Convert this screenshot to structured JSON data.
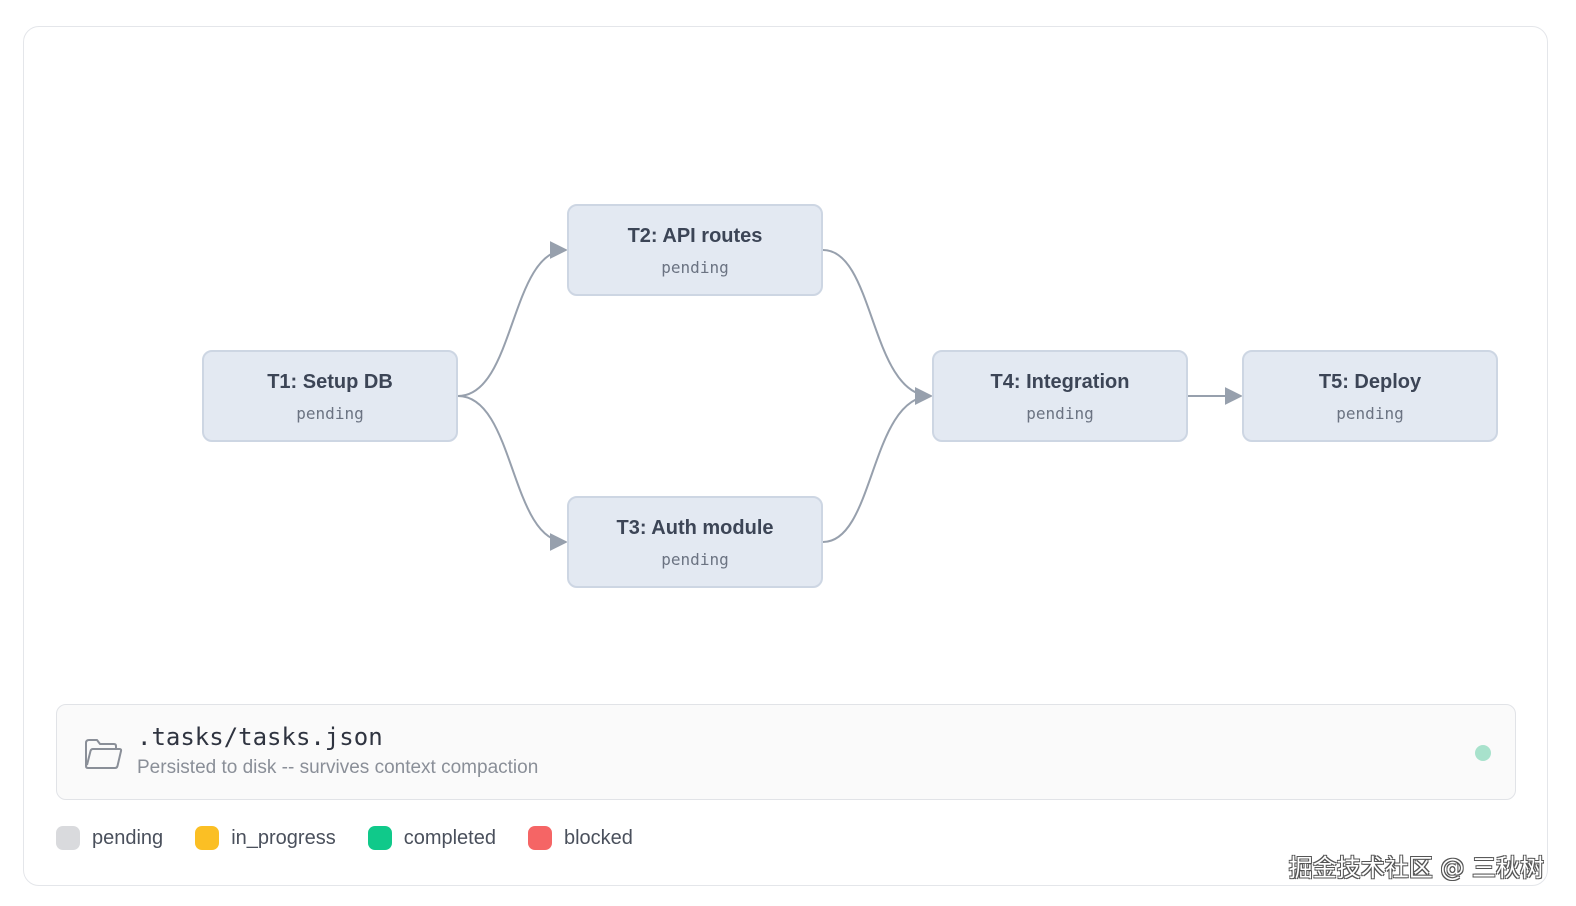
{
  "tasks": [
    {
      "id": "t1",
      "title": "T1: Setup DB",
      "status": "pending"
    },
    {
      "id": "t2",
      "title": "T2: API routes",
      "status": "pending"
    },
    {
      "id": "t3",
      "title": "T3: Auth module",
      "status": "pending"
    },
    {
      "id": "t4",
      "title": "T4: Integration",
      "status": "pending"
    },
    {
      "id": "t5",
      "title": "T5: Deploy",
      "status": "pending"
    }
  ],
  "edges": [
    {
      "from": "T1",
      "to": "T2"
    },
    {
      "from": "T1",
      "to": "T3"
    },
    {
      "from": "T2",
      "to": "T4"
    },
    {
      "from": "T3",
      "to": "T4"
    },
    {
      "from": "T4",
      "to": "T5"
    }
  ],
  "storage": {
    "path": ".tasks/tasks.json",
    "description": "Persisted to disk -- survives context compaction",
    "icon": "folder-open-icon",
    "indicator_color": "#a8e2cc"
  },
  "legend": [
    {
      "label": "pending",
      "color": "#d9dadd"
    },
    {
      "label": "in_progress",
      "color": "#fbbf24"
    },
    {
      "label": "completed",
      "color": "#10c98a"
    },
    {
      "label": "blocked",
      "color": "#f56565"
    }
  ],
  "colors": {
    "node_fill": "#e3e9f2",
    "node_border": "#cdd6e3",
    "edge": "#97a0ad"
  },
  "watermark": "掘金技术社区 @ 三秋树"
}
